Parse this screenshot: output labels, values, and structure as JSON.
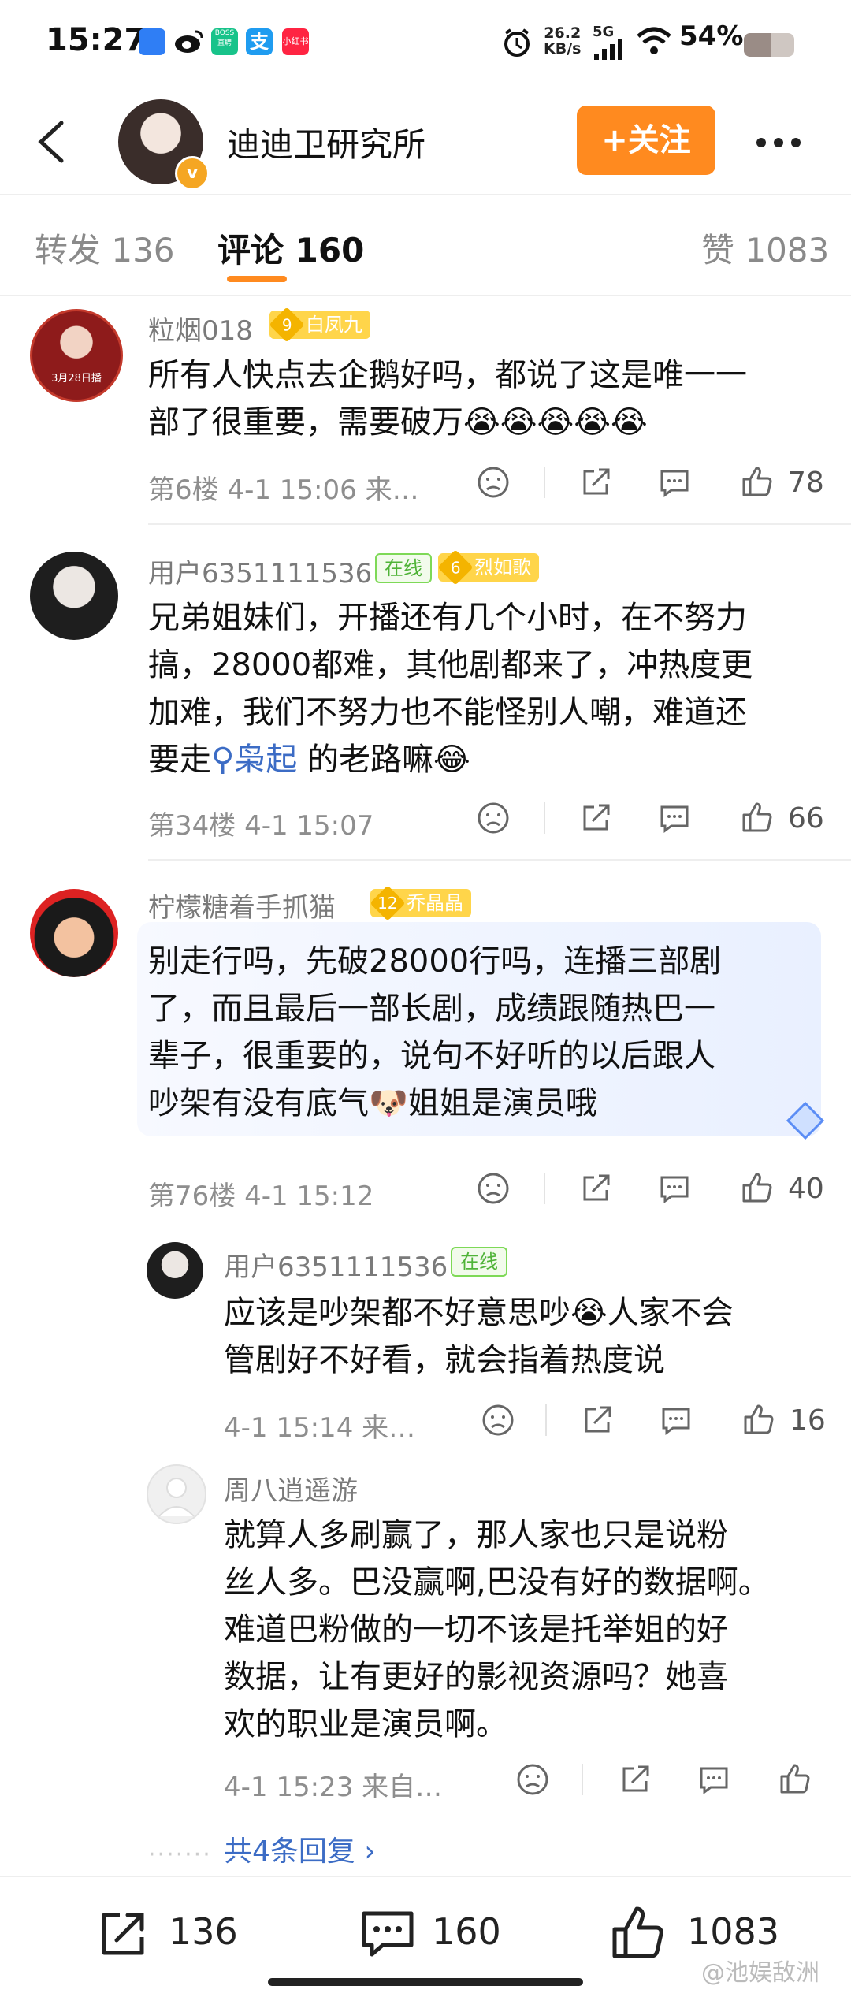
{
  "status_bar": {
    "time": "15:27",
    "net_speed_value": "26.2",
    "net_speed_unit": "KB/s",
    "network": "5G",
    "battery": "54%",
    "battery_level": 0.54,
    "app_icons": [
      "box-app-icon",
      "weibo-icon",
      "boss-zhipin-icon",
      "zhi-app-icon",
      "xiaohongshu-icon"
    ],
    "boss_label": "BOSS\n直聘",
    "xhs_label": "小红书"
  },
  "header": {
    "account_name": "迪迪卫研究所",
    "verified_badge": "v",
    "follow_label": "+关注"
  },
  "tabs": [
    {
      "label": "转发 136"
    },
    {
      "label": "评论 160"
    },
    {
      "label": "赞 1083"
    }
  ],
  "comments": [
    {
      "username": "粒烟018",
      "level": "9",
      "level_name": "白凤九",
      "text_lines": [
        "所有人快点去企鹅好吗，都说了这是唯一一",
        "部了很重要，需要破万😭😭😭😭😭"
      ],
      "meta": "第6楼  4-1 15:06  来…",
      "likes": "78",
      "avatar_caption": "3月28日播"
    },
    {
      "username": "用户6351111536",
      "online": "在线",
      "level": "6",
      "level_name": "烈如歌",
      "text_lines": [
        "兄弟姐妹们，开播还有几个小时，在不努力",
        "搞，28000都难，其他剧都来了，冲热度更",
        "加难，我们不努力也不能怪别人嘲，难道还"
      ],
      "text_last_prefix": "要走",
      "topic": "枭起",
      "text_last_suffix": " 的老路嘛😂",
      "meta": "第34楼  4-1 15:07",
      "likes": "66"
    },
    {
      "username": "柠檬糖着手抓猫",
      "level": "12",
      "level_name": "乔晶晶",
      "text_lines": [
        "别走行吗，先破28000行吗，连播三部剧",
        "了，而且最后一部长剧，成绩跟随热巴一",
        "辈子，很重要的，说句不好听的以后跟人",
        "吵架有没有底气🐶姐姐是演员哦"
      ],
      "meta": "第76楼  4-1 15:12",
      "likes": "40"
    }
  ],
  "replies": [
    {
      "username": "用户6351111536",
      "online": "在线",
      "text_lines": [
        "应该是吵架都不好意思吵😭人家不会",
        "管剧好不好看，就会指着热度说"
      ],
      "meta": "4-1 15:14  来…",
      "likes": "16"
    },
    {
      "username": "周八逍遥游",
      "text_lines": [
        "就算人多刷赢了，那人家也只是说粉",
        "丝人多。巴没赢啊,巴没有好的数据啊。",
        "难道巴粉做的一切不该是托举姐的好",
        "数据，让有更好的影视资源吗？她喜",
        "欢的职业是演员啊。"
      ],
      "meta": "4-1 15:23  来自…",
      "likes": ""
    }
  ],
  "more_replies": "共4条回复 ›",
  "bottom_bar": {
    "repost_count": "136",
    "comment_count": "160",
    "like_count": "1083"
  },
  "watermark": "@池娱敌洲",
  "colors": {
    "accent": "#ff8a1f",
    "topic_link": "#3c6cc5",
    "online_green": "#4fb338",
    "level_gold": "#ffd54a"
  }
}
